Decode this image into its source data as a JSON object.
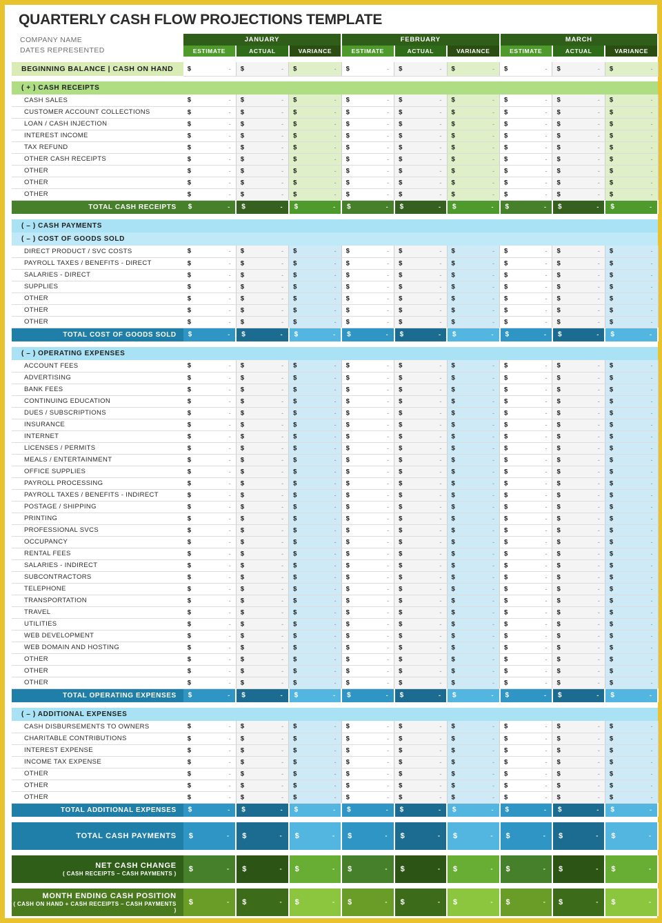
{
  "title": "QUARTERLY CASH FLOW PROJECTIONS TEMPLATE",
  "meta": {
    "company_label": "COMPANY NAME",
    "dates_label": "DATES REPRESENTED"
  },
  "months": [
    "JANUARY",
    "FEBRUARY",
    "MARCH"
  ],
  "subcolumns": [
    "ESTIMATE",
    "ACTUAL",
    "VARIANCE"
  ],
  "currency_symbol": "$",
  "empty_value": "-",
  "beginning_balance_label": "BEGINNING BALANCE | CASH ON HAND",
  "sections": [
    {
      "id": "cash-receipts",
      "header": "( + )  CASH RECEIPTS",
      "theme": "green",
      "rows": [
        "CASH SALES",
        "CUSTOMER ACCOUNT COLLECTIONS",
        "LOAN / CASH INJECTION",
        "INTEREST INCOME",
        "TAX REFUND",
        "OTHER CASH RECEIPTS",
        "OTHER",
        "OTHER",
        "OTHER"
      ],
      "total_label": "TOTAL CASH RECEIPTS"
    },
    {
      "id": "cost-of-goods-sold",
      "header": "( – )  COST OF GOODS SOLD",
      "parent_header": "( – )  CASH PAYMENTS",
      "theme": "blue",
      "rows": [
        "DIRECT PRODUCT / SVC COSTS",
        "PAYROLL TAXES / BENEFITS - DIRECT",
        "SALARIES - DIRECT",
        "SUPPLIES",
        "OTHER",
        "OTHER",
        "OTHER"
      ],
      "total_label": "TOTAL COST OF GOODS SOLD"
    },
    {
      "id": "operating-expenses",
      "header": "( – )  OPERATING EXPENSES",
      "theme": "blue",
      "rows": [
        "ACCOUNT FEES",
        "ADVERTISING",
        "BANK FEES",
        "CONTINUING EDUCATION",
        "DUES / SUBSCRIPTIONS",
        "INSURANCE",
        "INTERNET",
        "LICENSES / PERMITS",
        "MEALS / ENTERTAINMENT",
        "OFFICE SUPPLIES",
        "PAYROLL PROCESSING",
        "PAYROLL TAXES / BENEFITS - INDIRECT",
        "POSTAGE / SHIPPING",
        "PRINTING",
        "PROFESSIONAL SVCS",
        "OCCUPANCY",
        "RENTAL FEES",
        "SALARIES - INDIRECT",
        "SUBCONTRACTORS",
        "TELEPHONE",
        "TRANSPORTATION",
        "TRAVEL",
        "UTILITIES",
        "WEB DEVELOPMENT",
        "WEB DOMAIN AND HOSTING",
        "OTHER",
        "OTHER",
        "OTHER"
      ],
      "total_label": "TOTAL OPERATING EXPENSES"
    },
    {
      "id": "additional-expenses",
      "header": "( – )  ADDITIONAL EXPENSES",
      "theme": "blue",
      "rows": [
        "CASH DISBURSEMENTS TO OWNERS",
        "CHARITABLE CONTRIBUTIONS",
        "INTEREST EXPENSE",
        "INCOME TAX EXPENSE",
        "OTHER",
        "OTHER",
        "OTHER"
      ],
      "total_label": "TOTAL ADDITIONAL EXPENSES"
    }
  ],
  "summary": [
    {
      "id": "total-cash-payments",
      "line1": "TOTAL CASH PAYMENTS",
      "line2": ""
    },
    {
      "id": "net-cash-change",
      "line1": "NET CASH CHANGE",
      "line2": "( CASH RECEIPTS – CASH PAYMENTS )"
    },
    {
      "id": "month-ending-cash-position",
      "line1": "MONTH ENDING CASH POSITION",
      "line2": "( CASH ON HAND + CASH RECEIPTS – CASH PAYMENTS )"
    }
  ],
  "colors": {
    "frame": "#e8c32e",
    "green_dark": "#2f5e18",
    "green_mid": "#46802a",
    "green_light": "#aedd84",
    "blue_header": "#a9e2f4",
    "blue_total": "#1f7fa8",
    "beginning_balance": "#d9ecb6"
  }
}
